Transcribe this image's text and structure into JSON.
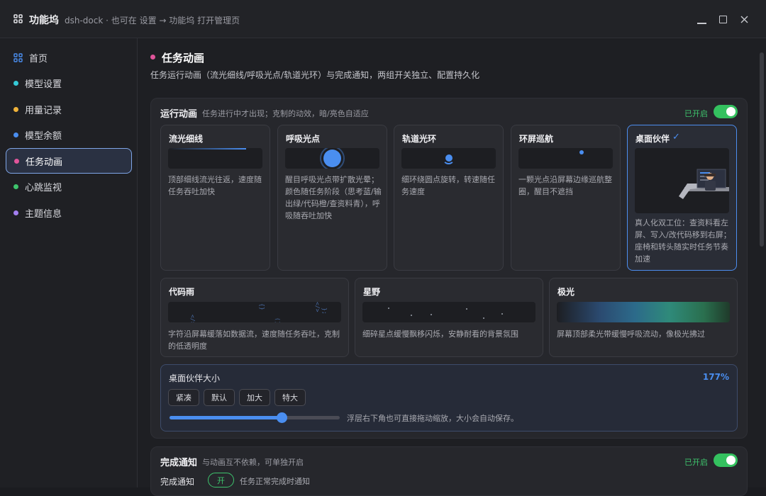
{
  "window": {
    "title": "功能坞",
    "subtitle": "dsh-dock · 也可在 设置 → 功能坞 打开管理页",
    "minimize": "—",
    "maximize": "☐",
    "close": "✕"
  },
  "sidebar": {
    "items": [
      {
        "label": "首页",
        "color": "#4a8ef0",
        "icon": "grid-icon"
      },
      {
        "label": "模型设置",
        "color": "#35c9d6"
      },
      {
        "label": "用量记录",
        "color": "#f0b33a"
      },
      {
        "label": "模型余额",
        "color": "#4a8ef0"
      },
      {
        "label": "任务动画",
        "color": "#e0559a",
        "active": true
      },
      {
        "label": "心跳监视",
        "color": "#3ec46d"
      },
      {
        "label": "主题信息",
        "color": "#a37ff0"
      }
    ]
  },
  "section": {
    "title": "任务动画",
    "desc": "任务运行动画（流光细线/呼吸光点/轨道光环）与完成通知，两组开关独立、配置持久化"
  },
  "run_panel": {
    "title": "运行动画",
    "subtitle": "任务进行中才出现；克制的动效，暗/亮色自适应",
    "status": "已开启",
    "cards_row1": [
      {
        "title": "流光细线",
        "desc": "顶部细线流光往返，速度随任务吞吐加快"
      },
      {
        "title": "呼吸光点",
        "desc": "醒目呼吸光点带扩散光晕；颜色随任务阶段（思考蓝/输出绿/代码橙/查资料青），呼吸随吞吐加快"
      },
      {
        "title": "轨道光环",
        "desc": "细环绕圆点旋转，转速随任务速度"
      },
      {
        "title": "环屏巡航",
        "desc": "一颗光点沿屏幕边缘巡航整圈，醒目不遮挡"
      },
      {
        "title": "桌面伙伴",
        "check": "✓",
        "desc": "真人化双工位：查资料看左屏、写入/改代码移到右屏；座椅和转头随实时任务节奏加速",
        "selected": true
      }
    ],
    "cards_row2": [
      {
        "title": "代码雨",
        "desc": "字符沿屏幕缓落如数据流，速度随任务吞吐，克制的低透明度",
        "rain": [
          "</>",
          "{}",
          "</>",
          "()",
          "};"
        ]
      },
      {
        "title": "星野",
        "desc": "细碎星点缓慢飘移闪烁，安静耐看的背景氛围"
      },
      {
        "title": "极光",
        "desc": "屏幕顶部柔光带缓慢呼吸流动，像极光拂过"
      }
    ],
    "size": {
      "title": "桌面伙伴大小",
      "value": "177%",
      "level": 0.66,
      "buttons": [
        "紧凑",
        "默认",
        "加大",
        "特大"
      ],
      "hint": "浮层右下角也可直接拖动缩放，大小会自动保存。"
    }
  },
  "notify_panel": {
    "title": "完成通知",
    "subtitle": "与动画互不依赖，可单独开启",
    "status": "已开启",
    "row_label": "完成通知",
    "pill": "开",
    "row_desc": "任务正常完成时通知"
  }
}
